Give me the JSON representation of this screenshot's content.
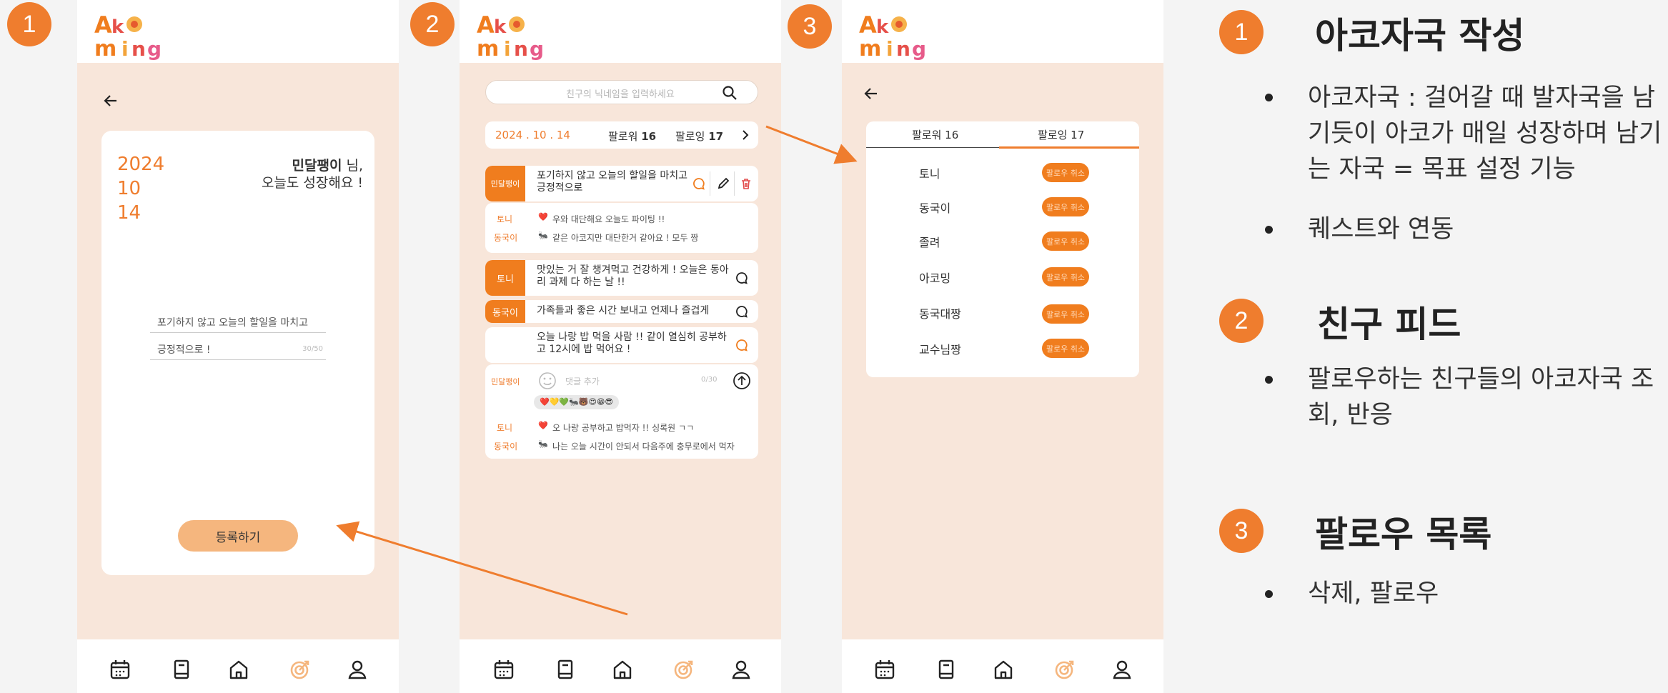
{
  "badges": [
    "1",
    "2",
    "3"
  ],
  "screen1": {
    "year": "2024",
    "month": "10",
    "day": "14",
    "user_name": "민달팽이",
    "user_suffix": " 님,",
    "greeting": "오늘도 성장해요 !",
    "input_line1": "포기하지 않고 오늘의 할일을 마치고",
    "input_line2": "긍정적으로 !",
    "char_count": "30/50",
    "register_label": "등록하기"
  },
  "screen2": {
    "search_placeholder": "친구의 닉네임을 입력하세요",
    "date": "2024 . 10 . 14",
    "follower_label": "팔로워",
    "follower_count": "16",
    "following_label": "팔로잉",
    "following_count": "17",
    "posts": [
      {
        "author": "민달팽이",
        "text": "포기하지 않고 오늘의 할일을 마치고 긍정적으로"
      },
      {
        "author": "토니",
        "text": "맛있는 거 잘 챙겨먹고 건강하게 ! 오늘은 동아리 과제 다 하는 날 !!"
      },
      {
        "author": "동국이",
        "text": "가족들과 좋은 시간 보내고 언제나 즐겁게"
      },
      {
        "author": "",
        "text": "오늘 나랑 밥 먹을 사람 !! 같이 열심히 공부하고 12시에 밥 먹어요 !"
      }
    ],
    "comments_post1": [
      {
        "name": "토니",
        "emoji": "❤️",
        "text": "우와 대단해요 오늘도 파이팅 !!"
      },
      {
        "name": "동국이",
        "emoji": "🐜",
        "text": "같은 아코지만 대단한거 같아요 ! 모두 짱"
      }
    ],
    "comment_input": {
      "name": "민달팽이",
      "placeholder": "댓글 추가",
      "count": "0/30"
    },
    "reaction_emojis": "❤️💛💚🐜🐻😍😁😎",
    "comments_post4": [
      {
        "name": "토니",
        "emoji": "❤️",
        "text": "오 나랑 공부하고 밥먹자 !! 싱록원 ㄱㄱ"
      },
      {
        "name": "동국이",
        "emoji": "🐜",
        "text": "나는 오늘 시간이 안되서 다음주에 충무로에서 먹자"
      }
    ]
  },
  "screen3": {
    "tab_follower": "팔로워 16",
    "tab_following": "팔로잉 17",
    "friends": [
      "토니",
      "동국이",
      "졸려",
      "아코밍",
      "동국대짱",
      "교수님짱"
    ],
    "unfollow_label": "팔로우 취소"
  },
  "right_panel": {
    "sections": [
      {
        "num": "1",
        "title": "아코자국 작성",
        "bullets": [
          "아코자국 : 걸어갈 때 발자국을 남\n기듯이 아코가 매일 성장하며 남기\n는 자국 = 목표 설정 기능",
          "퀘스트와 연동"
        ]
      },
      {
        "num": "2",
        "title": "친구 피드",
        "bullets": [
          "팔로우하는 친구들의 아코자국 조\n회, 반응"
        ]
      },
      {
        "num": "3",
        "title": "팔로우 목록",
        "bullets": [
          "삭제, 팔로우"
        ]
      }
    ]
  },
  "nav_icons": [
    "calendar-icon",
    "book-icon",
    "home-icon",
    "target-icon",
    "user-icon"
  ],
  "colors": {
    "accent": "#ef7d2e",
    "peach": "#f8e6da",
    "button": "#f5b67e"
  }
}
